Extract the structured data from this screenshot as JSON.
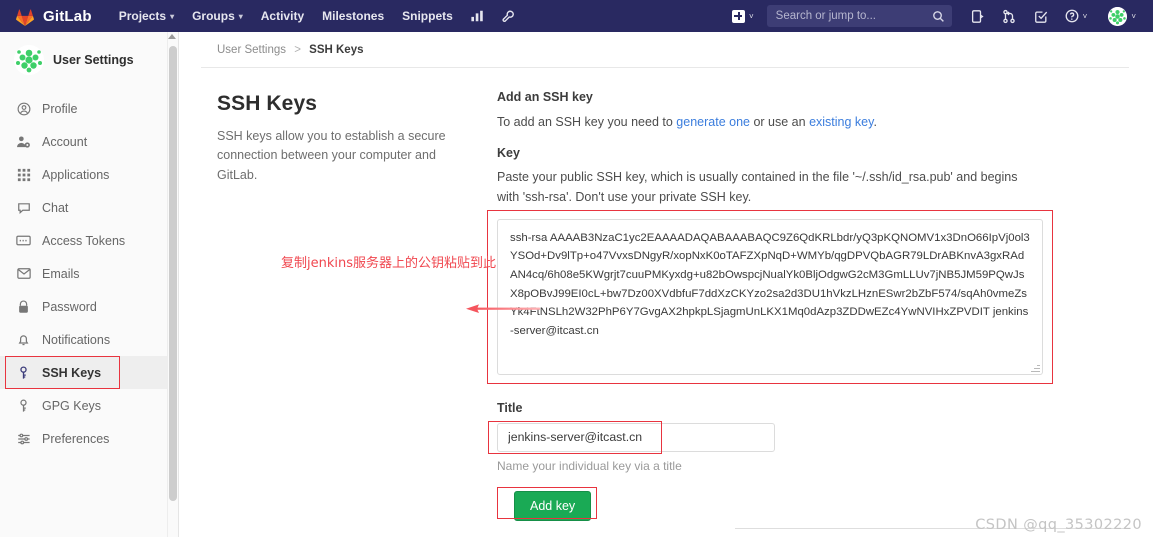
{
  "navbar": {
    "brand": "GitLab",
    "links": [
      {
        "label": "Projects",
        "caret": true
      },
      {
        "label": "Groups",
        "caret": true
      },
      {
        "label": "Activity",
        "caret": false
      },
      {
        "label": "Milestones",
        "caret": false
      },
      {
        "label": "Snippets",
        "caret": false
      }
    ],
    "icon_analytics": "chart-icon",
    "icon_wrench": "wrench-icon",
    "new_caret": "˅",
    "search_placeholder": "Search or jump to...",
    "icon_issues": "issues-icon",
    "icon_merge_requests": "merge-request-icon",
    "icon_todos": "todos-icon",
    "icon_help": "help-icon",
    "help_caret": "˅",
    "avatar_caret": "˅"
  },
  "sidebar": {
    "title": "User Settings",
    "items": [
      {
        "label": "Profile",
        "icon": "user-circle-icon",
        "active": false
      },
      {
        "label": "Account",
        "icon": "account-gear-icon",
        "active": false
      },
      {
        "label": "Applications",
        "icon": "applications-grid-icon",
        "active": false
      },
      {
        "label": "Chat",
        "icon": "chat-bubble-icon",
        "active": false
      },
      {
        "label": "Access Tokens",
        "icon": "token-icon",
        "active": false
      },
      {
        "label": "Emails",
        "icon": "envelope-icon",
        "active": false
      },
      {
        "label": "Password",
        "icon": "lock-icon",
        "active": false
      },
      {
        "label": "Notifications",
        "icon": "bell-icon",
        "active": false
      },
      {
        "label": "SSH Keys",
        "icon": "key-icon",
        "active": true
      },
      {
        "label": "GPG Keys",
        "icon": "key-icon",
        "active": false
      },
      {
        "label": "Preferences",
        "icon": "sliders-icon",
        "active": false
      }
    ]
  },
  "breadcrumb": {
    "parent": "User Settings",
    "separator": ">",
    "current": "SSH Keys"
  },
  "page": {
    "heading": "SSH Keys",
    "description": "SSH keys allow you to establish a secure connection between your computer and GitLab."
  },
  "form": {
    "section_title": "Add an SSH key",
    "intro_prefix": "To add an SSH key you need to ",
    "intro_link1": "generate one",
    "intro_middle": " or use an ",
    "intro_link2": "existing key",
    "intro_suffix": ".",
    "key_label": "Key",
    "key_help": "Paste your public SSH key, which is usually contained in the file '~/.ssh/id_rsa.pub' and begins with 'ssh-rsa'. Don't use your private SSH key.",
    "key_value": "ssh-rsa AAAAB3NzaC1yc2EAAAADAQABAAABAQC9Z6QdKRLbdr/yQ3pKQNOMV1x3DnO66IpVj0ol3YSOd+Dv9lTp+o47VvxsDNgyR/xopNxK0oTAFZXpNqD+WMYb/qgDPVQbAGR79LDrABKnvA3gxRAdAN4cq/6h08e5KWgrjt7cuuPMKyxdg+u82bOwspcjNualYk0BljOdgwG2cM3GmLLUv7jNB5JM59PQwJsX8pOBvJ99EI0cL+bw7Dz00XVdbfuF7ddXzCKYzo2sa2d3DU1hVkzLHznESwr2bZbF574/sqAh0vmeZsYk4FtNSLh2W32PhP6Y7GvgAX2hpkpLSjagmUnLKX1Mq0dAzp3ZDDwEZc4YwNVIHxZPVDIT jenkins-server@itcast.cn",
    "title_label": "Title",
    "title_value": "jenkins-server@itcast.cn",
    "title_hint": "Name your individual key via a title",
    "submit_label": "Add key"
  },
  "annotation": {
    "text": "复制jenkins服务器上的公钥粘贴到此"
  },
  "watermark": {
    "text": "CSDN @qq_35302220"
  },
  "colors": {
    "navbar_bg": "#292961",
    "accent_green": "#1aaa55",
    "annotation_red": "#f0474f",
    "highlight_red": "#e8343f",
    "link_blue": "#3b7ddd"
  }
}
